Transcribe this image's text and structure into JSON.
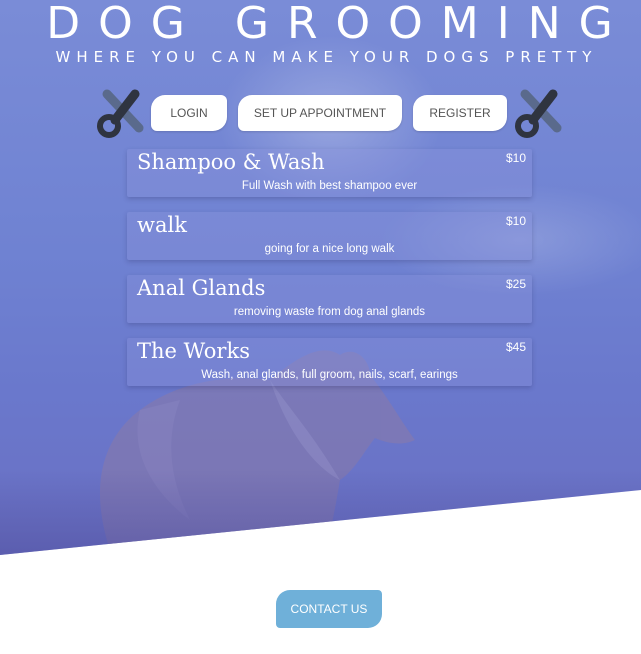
{
  "header": {
    "title": "DOG GROOMING",
    "subtitle": "WHERE YOU CAN MAKE YOUR DOGS PRETTY"
  },
  "nav": {
    "login": "LOGIN",
    "appointment": "SET UP APPOINTMENT",
    "register": "REGISTER",
    "left_icon": "scissors-icon",
    "right_icon": "scissors-icon"
  },
  "services": [
    {
      "name": "Shampoo & Wash",
      "price": "$10",
      "description": "Full Wash with best shampoo ever"
    },
    {
      "name": "walk",
      "price": "$10",
      "description": "going for a nice long walk"
    },
    {
      "name": "Anal Glands",
      "price": "$25",
      "description": "removing waste from dog anal glands"
    },
    {
      "name": "The Works",
      "price": "$45",
      "description": "Wash, anal glands, full groom, nails, scarf, earings"
    }
  ],
  "footer": {
    "contact": "CONTACT US"
  },
  "colors": {
    "hero": "#7a8cd7",
    "contact_button": "#6fb0d9",
    "scissors_dark": "#2f3440",
    "scissors_light": "#5a6a8c"
  }
}
